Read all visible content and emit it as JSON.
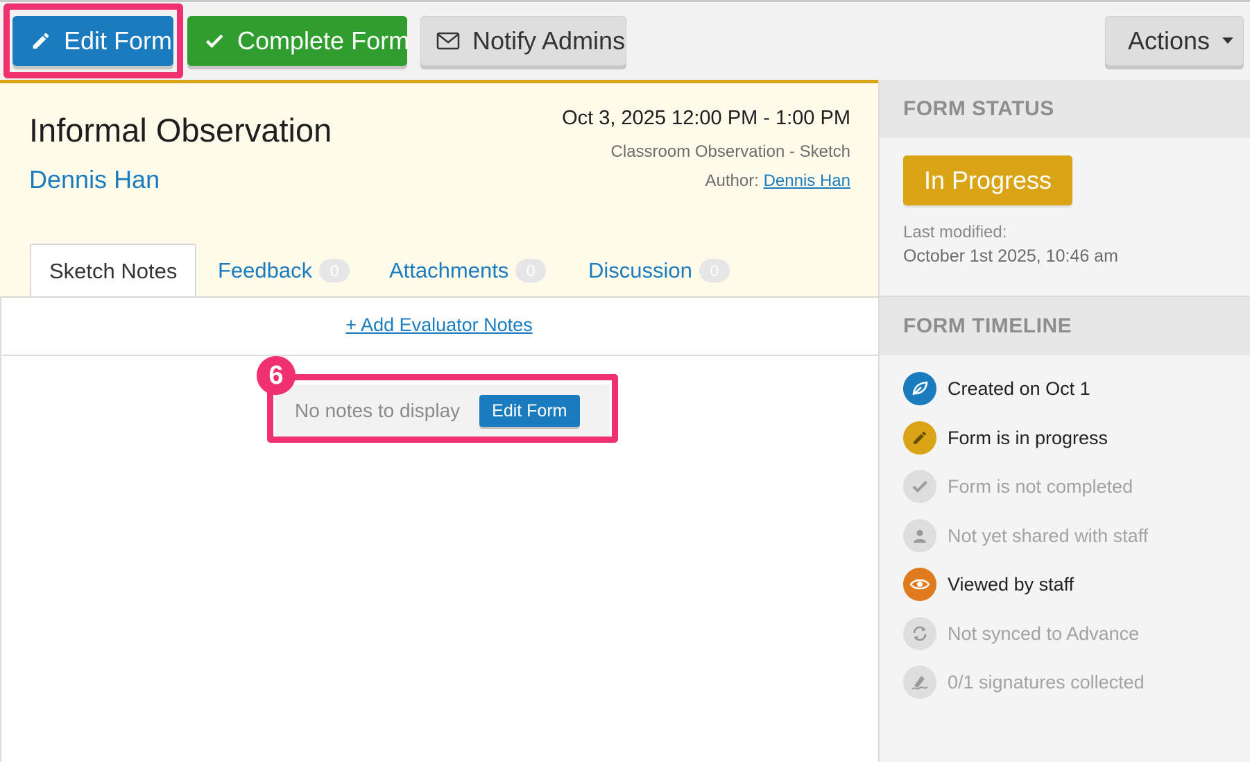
{
  "toolbar": {
    "edit_label": "Edit Form",
    "complete_label": "Complete Form",
    "notify_label": "Notify Admins",
    "actions_label": "Actions"
  },
  "header": {
    "title": "Informal Observation",
    "person": "Dennis Han",
    "datetime": "Oct 3, 2025 12:00 PM - 1:00 PM",
    "form_type": "Classroom Observation - Sketch",
    "author_label": "Author:",
    "author_name": "Dennis Han"
  },
  "tabs": [
    {
      "label": "Sketch Notes"
    },
    {
      "label": "Feedback",
      "count": "0"
    },
    {
      "label": "Attachments",
      "count": "0"
    },
    {
      "label": "Discussion",
      "count": "0"
    }
  ],
  "notes": {
    "add_link": "+ Add Evaluator Notes",
    "empty_text": "No notes to display",
    "edit_button": "Edit Form"
  },
  "annotation": {
    "step": "6",
    "color": "#f0306f"
  },
  "sidebar": {
    "status_header": "FORM STATUS",
    "status_value": "In Progress",
    "last_modified_label": "Last modified:",
    "last_modified_value": "October 1st 2025, 10:46 am",
    "timeline_header": "FORM TIMELINE",
    "timeline": [
      {
        "text": "Created on Oct 1",
        "icon": "leaf-icon",
        "state": "active",
        "color": "#1a7cbf"
      },
      {
        "text": "Form is in progress",
        "icon": "pencil-icon",
        "state": "active",
        "color": "#d9a516"
      },
      {
        "text": "Form is not completed",
        "icon": "check-icon",
        "state": "inactive",
        "color": "#dedede"
      },
      {
        "text": "Not yet shared with staff",
        "icon": "user-icon",
        "state": "inactive",
        "color": "#dedede"
      },
      {
        "text": "Viewed by staff",
        "icon": "eye-icon",
        "state": "active",
        "color": "#e07a1f"
      },
      {
        "text": "Not synced to Advance",
        "icon": "sync-icon",
        "state": "inactive",
        "color": "#dedede"
      },
      {
        "text": "0/1 signatures collected",
        "icon": "signature-icon",
        "state": "inactive",
        "color": "#dedede"
      }
    ]
  },
  "colors": {
    "primary": "#1a7cbf",
    "success": "#2f9e2f",
    "warning": "#d9a516",
    "header_bg": "#fffbeb"
  }
}
